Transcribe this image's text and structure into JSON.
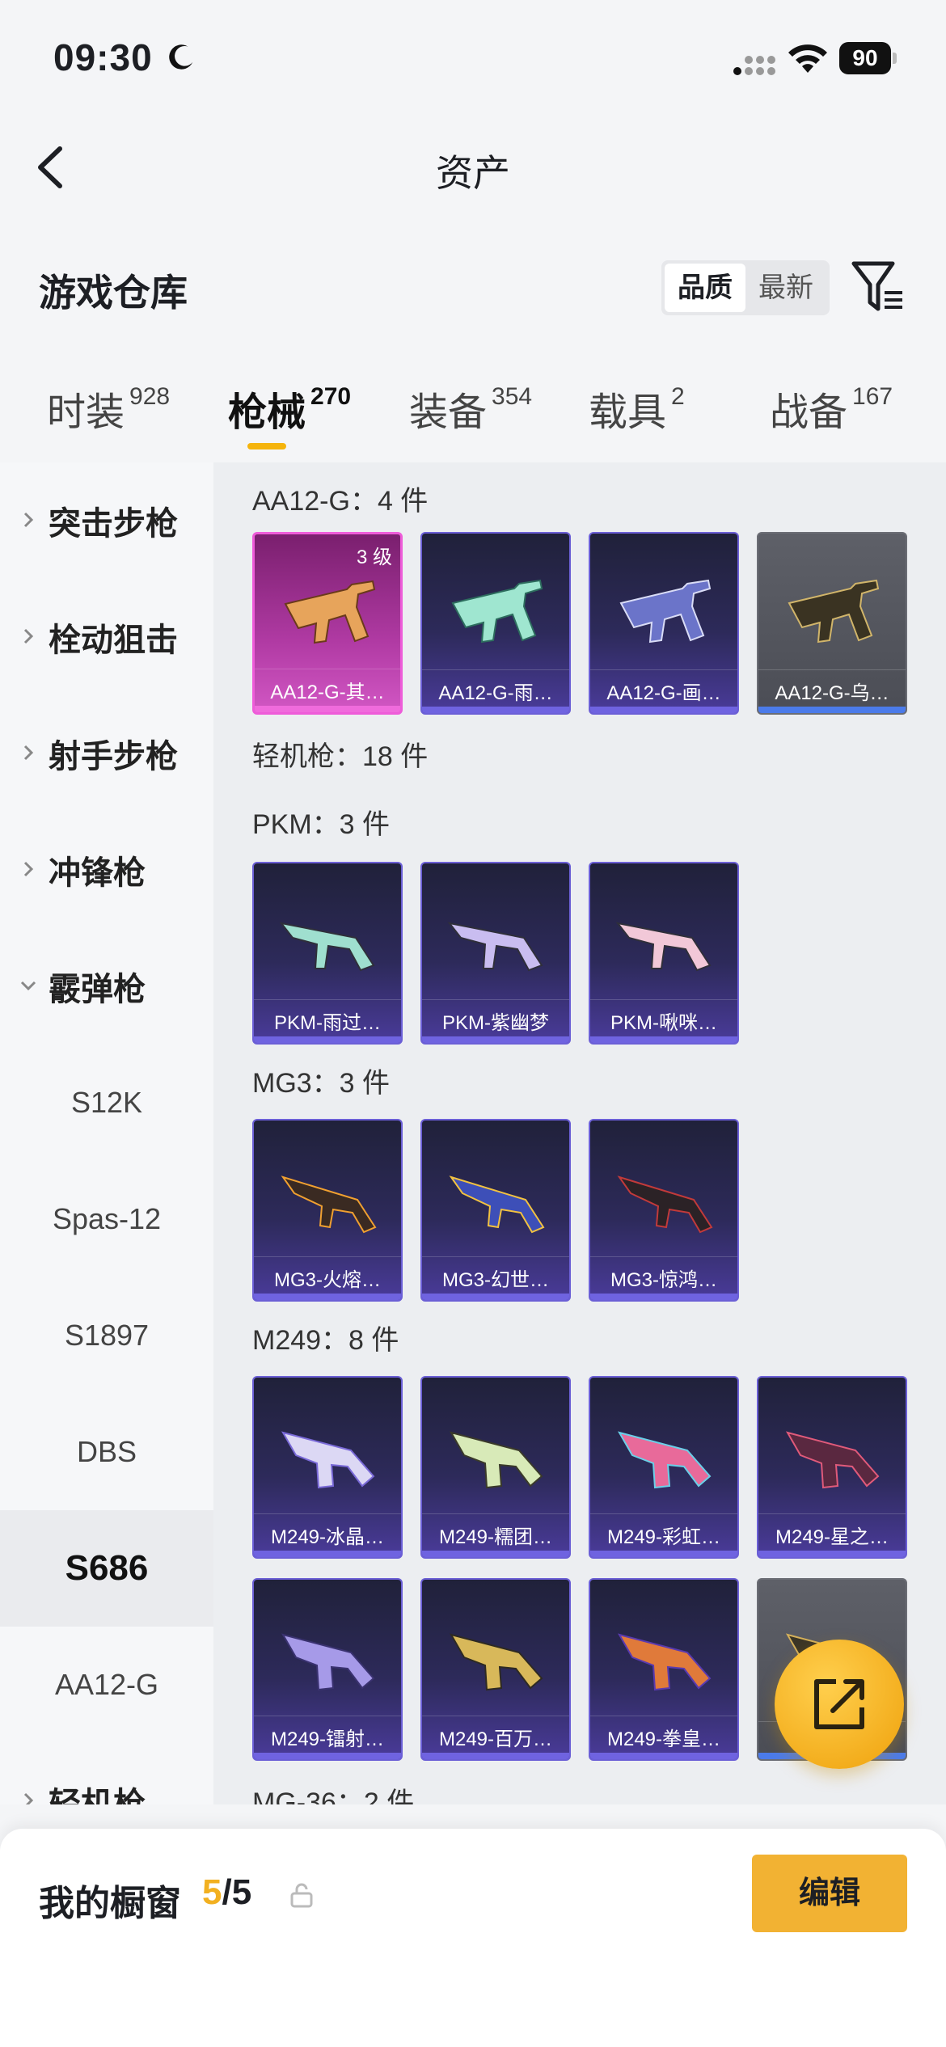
{
  "status_bar": {
    "time": "09:30",
    "battery": "90"
  },
  "nav": {
    "title": "资产"
  },
  "section": {
    "title": "游戏仓库",
    "sort_options": [
      "品质",
      "最新"
    ],
    "active_sort": "品质"
  },
  "tabs": [
    {
      "label": "时装",
      "count": "928"
    },
    {
      "label": "枪械",
      "count": "270",
      "active": true
    },
    {
      "label": "装备",
      "count": "354"
    },
    {
      "label": "载具",
      "count": "2"
    },
    {
      "label": "战备",
      "count": "167"
    }
  ],
  "sidebar": {
    "items": [
      {
        "label": "突击步枪",
        "type": "parent",
        "expanded": false
      },
      {
        "label": "栓动狙击",
        "type": "parent",
        "expanded": false
      },
      {
        "label": "射手步枪",
        "type": "parent",
        "expanded": false
      },
      {
        "label": "冲锋枪",
        "type": "parent",
        "expanded": false
      },
      {
        "label": "霰弹枪",
        "type": "parent",
        "expanded": true
      },
      {
        "label": "S12K",
        "type": "child"
      },
      {
        "label": "Spas-12",
        "type": "child"
      },
      {
        "label": "S1897",
        "type": "child"
      },
      {
        "label": "DBS",
        "type": "child"
      },
      {
        "label": "S686",
        "type": "child",
        "selected": true
      },
      {
        "label": "AA12-G",
        "type": "child"
      },
      {
        "label": "轻机枪",
        "type": "parent",
        "expanded": false
      }
    ]
  },
  "content": {
    "groups": [
      {
        "label": "AA12-G：4 件",
        "items": [
          {
            "name": "AA12-G-其…",
            "badge": "3 级",
            "rarity": "pink"
          },
          {
            "name": "AA12-G-雨…",
            "rarity": "purple"
          },
          {
            "name": "AA12-G-画…",
            "rarity": "purple"
          },
          {
            "name": "AA12-G-乌…",
            "rarity": "gray"
          }
        ]
      },
      {
        "label": "轻机枪：18 件",
        "items": []
      },
      {
        "label": "PKM：3 件",
        "items": [
          {
            "name": "PKM-雨过…",
            "rarity": "purple"
          },
          {
            "name": "PKM-紫幽梦",
            "rarity": "purple"
          },
          {
            "name": "PKM-啾咪…",
            "rarity": "purple"
          }
        ]
      },
      {
        "label": "MG3：3 件",
        "items": [
          {
            "name": "MG3-火熔…",
            "rarity": "purple"
          },
          {
            "name": "MG3-幻世…",
            "rarity": "purple"
          },
          {
            "name": "MG3-惊鸿…",
            "rarity": "purple"
          }
        ]
      },
      {
        "label": "M249：8 件",
        "items": [
          {
            "name": "M249-冰晶…",
            "rarity": "purple"
          },
          {
            "name": "M249-糯团…",
            "rarity": "purple"
          },
          {
            "name": "M249-彩虹…",
            "rarity": "purple"
          },
          {
            "name": "M249-星之…",
            "rarity": "purple"
          },
          {
            "name": "M249-镭射…",
            "rarity": "purple"
          },
          {
            "name": "M249-百万…",
            "rarity": "purple"
          },
          {
            "name": "M249-拳皇…",
            "rarity": "purple"
          },
          {
            "name": "M…",
            "rarity": "gray"
          }
        ]
      },
      {
        "label": "MG-36：2 件",
        "items": []
      }
    ]
  },
  "bottom": {
    "showcase_label": "我的橱窗",
    "showcase_current": "5",
    "showcase_total": "/5",
    "edit_label": "编辑"
  },
  "colors": {
    "accent": "#F2B233",
    "purple_card": "#2D2A5A",
    "pink_card": "#B03AA3"
  }
}
